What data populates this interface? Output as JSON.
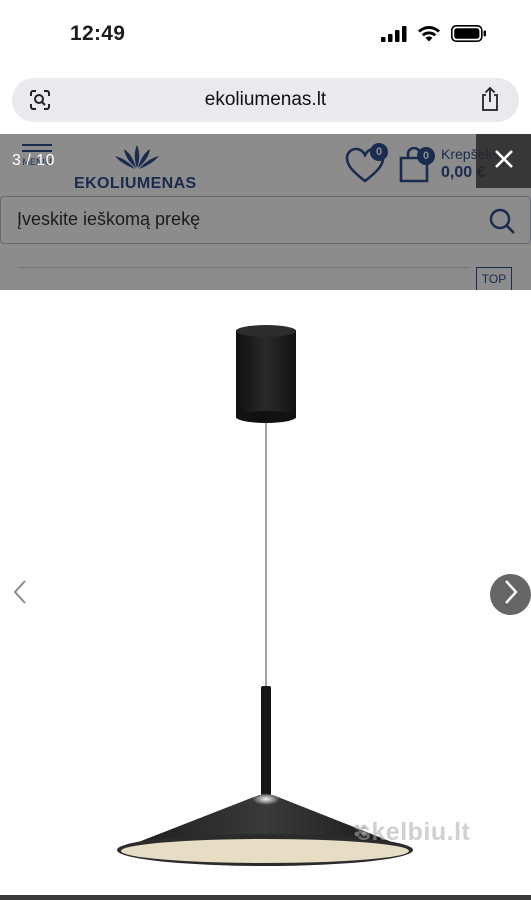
{
  "status_bar": {
    "time": "12:49"
  },
  "browser": {
    "url": "ekoliumenas.lt"
  },
  "site": {
    "menu_label": "MENIU",
    "logo_text": "EKOLIUMENAS",
    "wishlist_count": "0",
    "cart_count": "0",
    "cart_label": "Krepšelis",
    "cart_total": "0,00 €",
    "search_placeholder": "Įveskite ieškomą prekę",
    "top_button": "TOP",
    "brand_color": "#2f4f8f"
  },
  "lightbox": {
    "counter": "3 / 10",
    "watermark": "skelbiu.lt"
  },
  "icons": [
    "camera-search-icon",
    "share-icon",
    "heart-icon",
    "bag-icon",
    "search-icon",
    "close-icon",
    "chevron-left-icon",
    "chevron-right-icon",
    "signal-icon",
    "wifi-icon",
    "battery-icon"
  ]
}
